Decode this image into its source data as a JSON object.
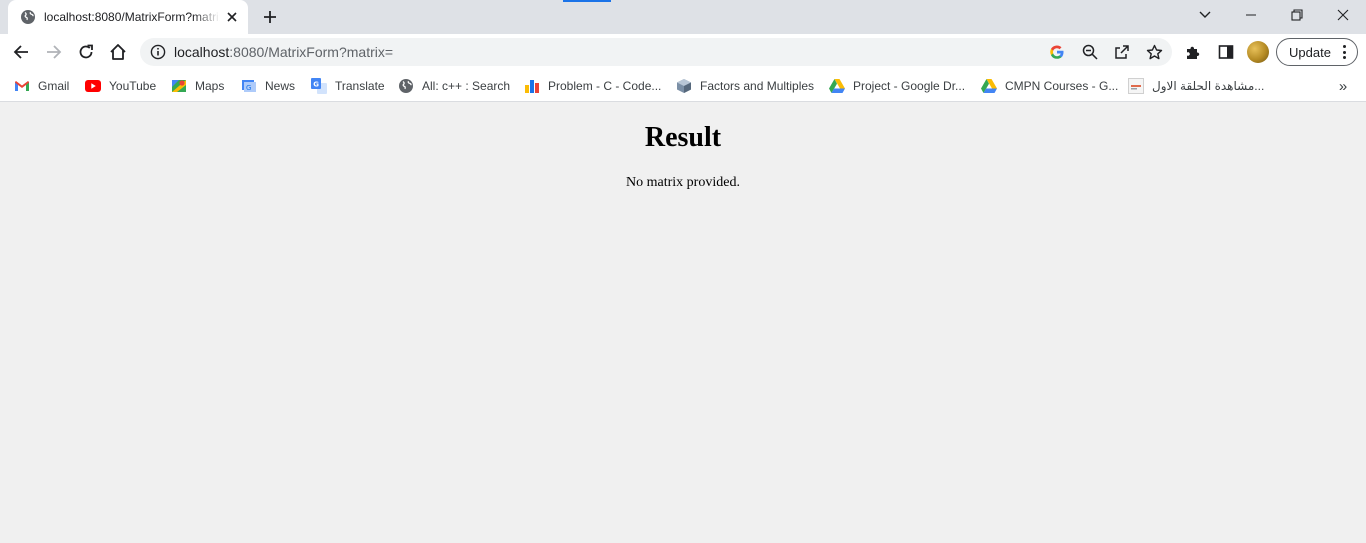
{
  "tab": {
    "title": "localhost:8080/MatrixForm?matrix=",
    "favicon": "globe-icon"
  },
  "window_controls": [
    "tab-search-icon",
    "minimize-icon",
    "restore-icon",
    "close-icon"
  ],
  "toolbar": {
    "url_host": "localhost",
    "url_rest": ":8080/MatrixForm?matrix=",
    "update_label": "Update"
  },
  "bookmarks": [
    {
      "label": "Gmail",
      "icon": "gmail-icon"
    },
    {
      "label": "YouTube",
      "icon": "youtube-icon"
    },
    {
      "label": "Maps",
      "icon": "maps-icon"
    },
    {
      "label": "News",
      "icon": "news-icon"
    },
    {
      "label": "Translate",
      "icon": "translate-icon"
    },
    {
      "label": "All: c++ : Search",
      "icon": "globe-icon"
    },
    {
      "label": "Problem - C - Code...",
      "icon": "bar-chart-icon"
    },
    {
      "label": "Factors and Multiples",
      "icon": "cube-icon"
    },
    {
      "label": "Project - Google Dr...",
      "icon": "google-drive-icon"
    },
    {
      "label": "CMPN Courses - G...",
      "icon": "google-drive-icon"
    },
    {
      "label": "مشاهدة الحلقة الاول...",
      "icon": "site-icon"
    }
  ],
  "colors": {
    "tabstrip": "#dee1e6",
    "page_background": "#f0f0f0",
    "accent": "#1a73e8"
  },
  "page": {
    "heading": "Result",
    "message": "No matrix provided."
  }
}
